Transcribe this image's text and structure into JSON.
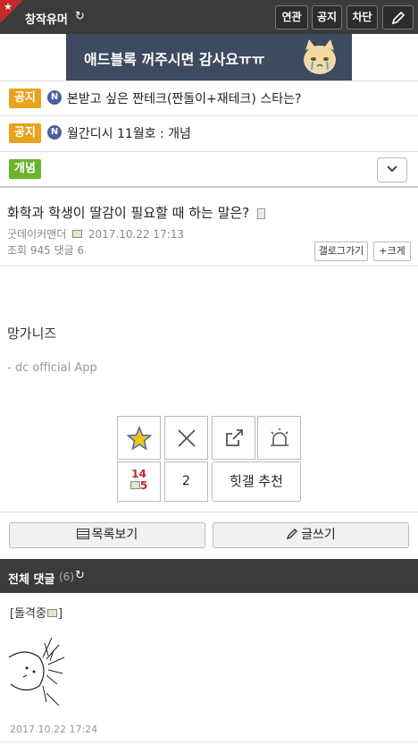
{
  "header": {
    "gallery_name": "창작유머",
    "refresh_icon": "↻",
    "buttons": [
      "연관",
      "공지",
      "차단"
    ],
    "write_icon": "pencil-icon"
  },
  "banner": {
    "text": "애드블록 꺼주시면 감사요ㅠㅠ",
    "bg": "#3d4a5f"
  },
  "notices": [
    {
      "badge": "공지",
      "title": "본받고 싶은 짠테크(짠돌이+재테크) 스타는?"
    },
    {
      "badge": "공지",
      "title": "월간디시 11월호 : 개념"
    }
  ],
  "filter": {
    "badge": "개념",
    "dropdown_icon": "chevron-down-icon"
  },
  "post": {
    "title": "화학과 학생이 딸감이 필요할 때 하는 말은?",
    "author": "굿데이커맨더",
    "date": "2017.10.22 17:13",
    "stats": "조회 945 댓글 6",
    "gallery_button": "갤로그가기",
    "size_button": "크게",
    "body": "망가니즈",
    "signature": "- dc official App"
  },
  "votes": {
    "up_count": "14",
    "fixed_up_count": "5",
    "down_count": "2",
    "recommend_label": "힛갤 추천"
  },
  "actions": {
    "list_label": "목록보기",
    "write_label": "글쓰기"
  },
  "comments": {
    "header": "전체 댓글",
    "count": "(6)",
    "items": [
      {
        "author": "[돌격중",
        "close": "]",
        "date": "2017.10.22 17:24"
      }
    ]
  },
  "colors": {
    "notice_badge": "#e8a31c",
    "concept_badge": "#6bb32e",
    "header": "#3b3b3b",
    "corner": "#c7282a"
  }
}
